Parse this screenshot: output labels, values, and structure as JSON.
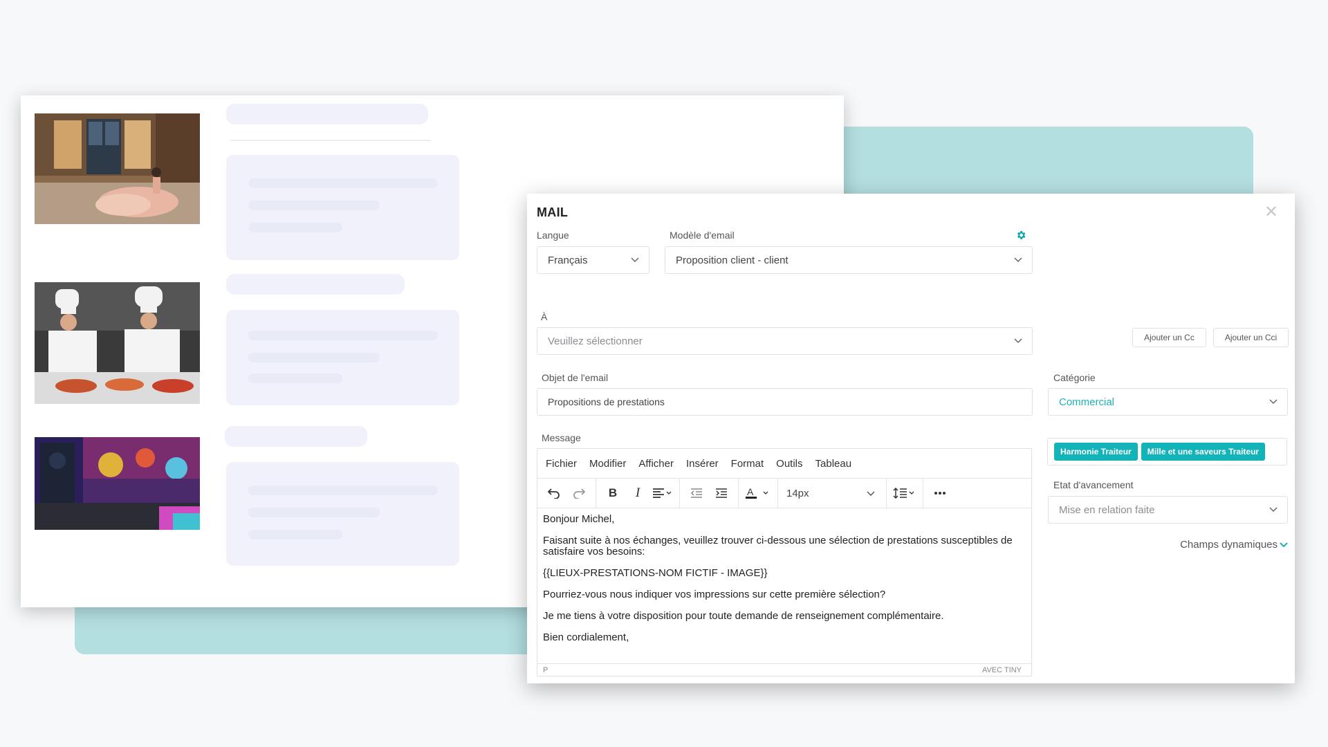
{
  "colors": {
    "accent": "#13b3ba",
    "teal_background": "#b3dfe1"
  },
  "mail": {
    "title": "MAIL",
    "langue": {
      "label": "Langue",
      "value": "Français"
    },
    "modele": {
      "label": "Modèle d'email",
      "value": "Proposition client - client",
      "settings_icon": "gear-icon"
    },
    "a": {
      "label": "À",
      "placeholder": "Veuillez sélectionner"
    },
    "cc_button": "Ajouter un Cc",
    "cci_button": "Ajouter un Cci",
    "objet": {
      "label": "Objet de l'email",
      "value": "Propositions de prestations"
    },
    "categorie": {
      "label": "Catégorie",
      "value": "Commercial"
    },
    "message": {
      "label": "Message"
    },
    "tags": [
      "Harmonie Traiteur",
      "Mille et une saveurs Traiteur"
    ],
    "etat": {
      "label": "Etat d'avancement",
      "value": "Mise en relation faite"
    },
    "champs_dynamiques": "Champs dynamiques"
  },
  "editor": {
    "menu": [
      "Fichier",
      "Modifier",
      "Afficher",
      "Insérer",
      "Format",
      "Outils",
      "Tableau"
    ],
    "font_size": "14px",
    "body": [
      "Bonjour Michel,",
      "Faisant suite à nos échanges, veuillez trouver ci-dessous une sélection de prestations susceptibles de satisfaire vos besoins:",
      "{{LIEUX-PRESTATIONS-NOM FICTIF - IMAGE}}",
      "Pourriez-vous nous indiquer vos impressions sur cette première sélection?",
      "Je me tiens à votre disposition pour toute demande de renseignement complémentaire.",
      "Bien cordialement,"
    ],
    "status_path": "P",
    "branding": "AVEC TINY"
  }
}
